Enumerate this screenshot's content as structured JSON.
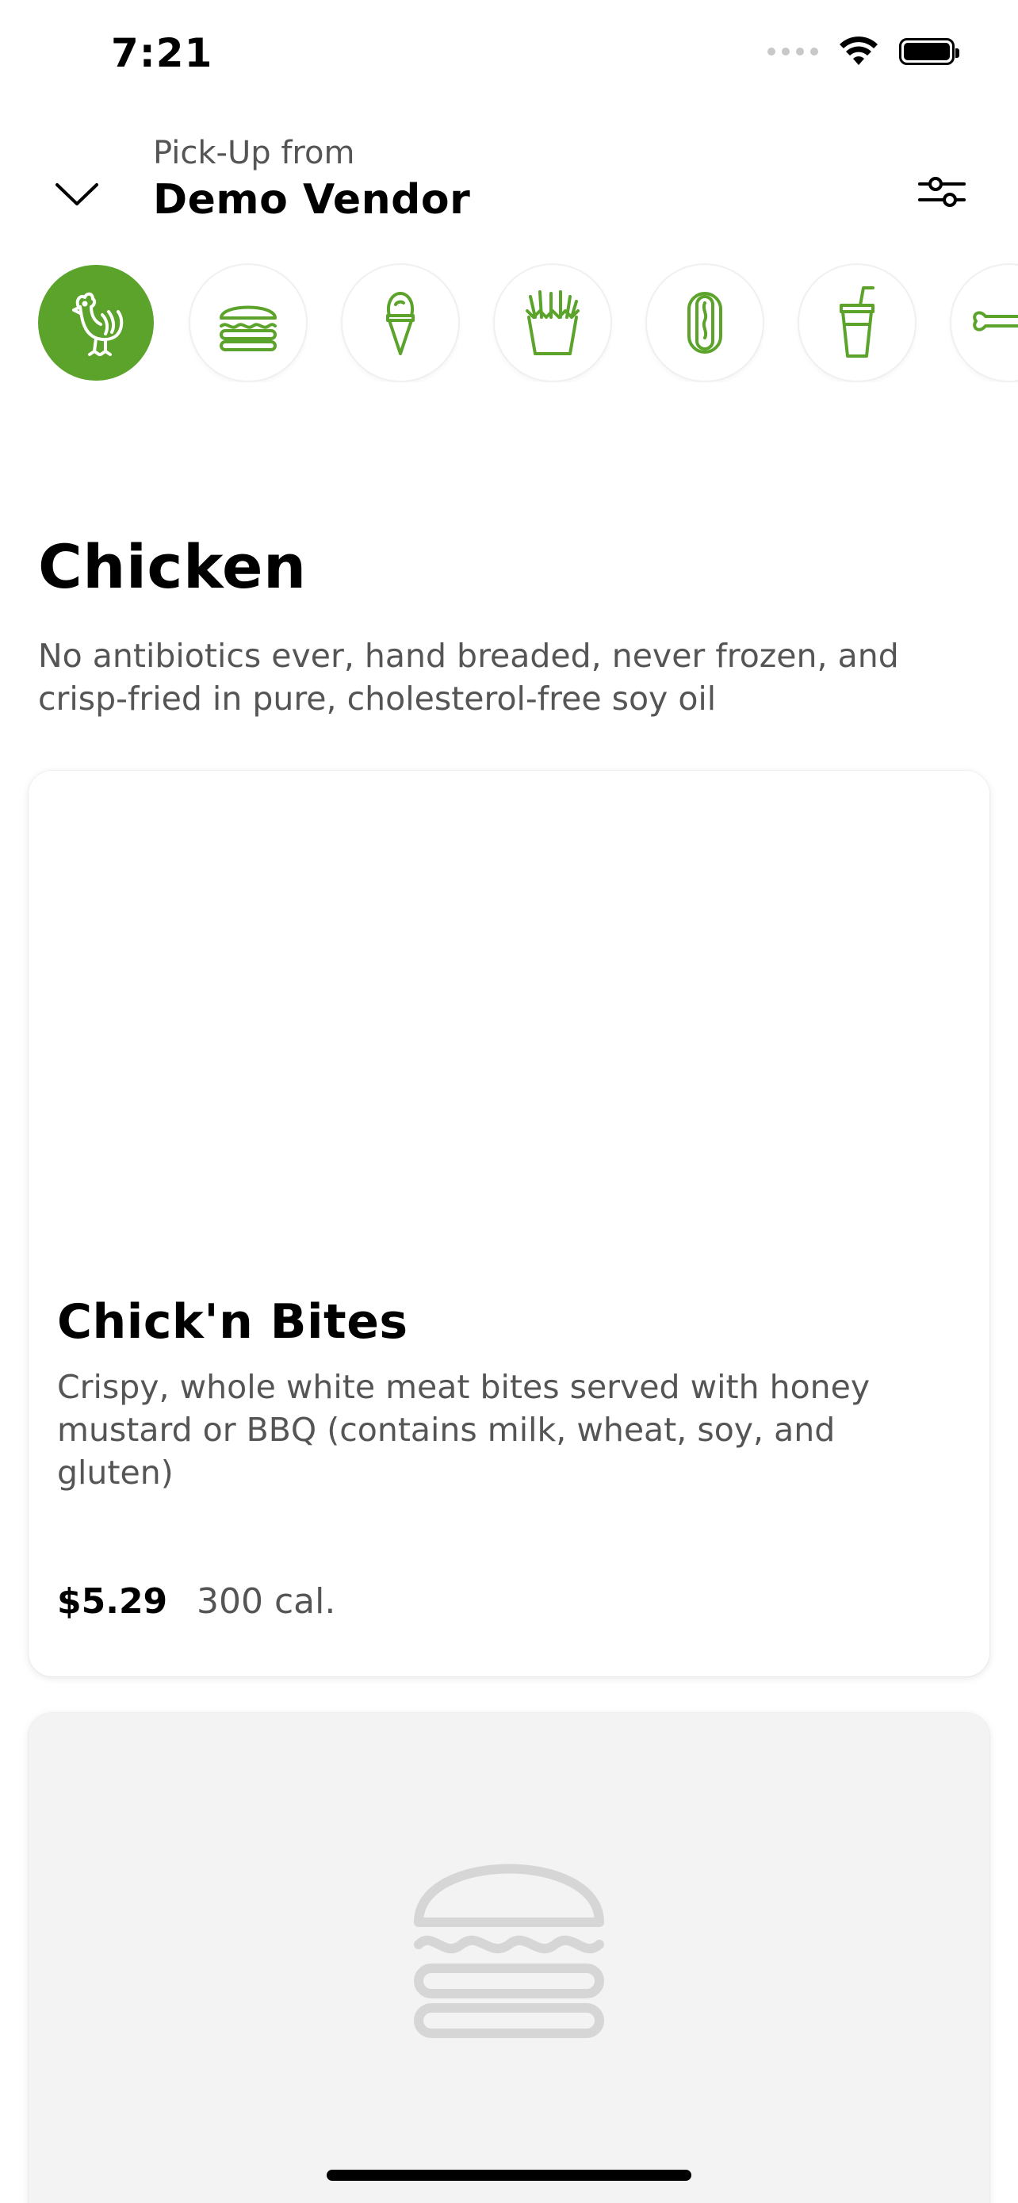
{
  "status_bar": {
    "time": "7:21"
  },
  "header": {
    "pickup_label": "Pick-Up from",
    "vendor_name": "Demo Vendor"
  },
  "categories": [
    {
      "name": "chicken",
      "icon": "chicken-icon",
      "active": true
    },
    {
      "name": "burgers",
      "icon": "burger-icon",
      "active": false
    },
    {
      "name": "frozen-custard",
      "icon": "ice-cream-cone-icon",
      "active": false
    },
    {
      "name": "fries",
      "icon": "fries-icon",
      "active": false
    },
    {
      "name": "hot-dogs",
      "icon": "hot-dog-icon",
      "active": false
    },
    {
      "name": "drinks",
      "icon": "drink-cup-icon",
      "active": false
    },
    {
      "name": "dog-treats",
      "icon": "dog-bone-icon",
      "active": false
    }
  ],
  "section": {
    "title": "Chicken",
    "description": "No antibiotics ever, hand breaded, never frozen, and crisp-fried in pure, cholesterol-free soy oil"
  },
  "items": [
    {
      "title": "Chick'n Bites",
      "description": "Crispy, whole white meat bites served with honey mustard or BBQ (contains milk, wheat, soy, and gluten)",
      "price": "$5.29",
      "calories": "300 cal."
    },
    {
      "placeholder_icon": "burger-icon"
    }
  ],
  "colors": {
    "accent": "#5ba32b",
    "muted_text": "#555555",
    "placeholder_bg": "#f3f3f3",
    "placeholder_icon": "#d6d6d6"
  }
}
